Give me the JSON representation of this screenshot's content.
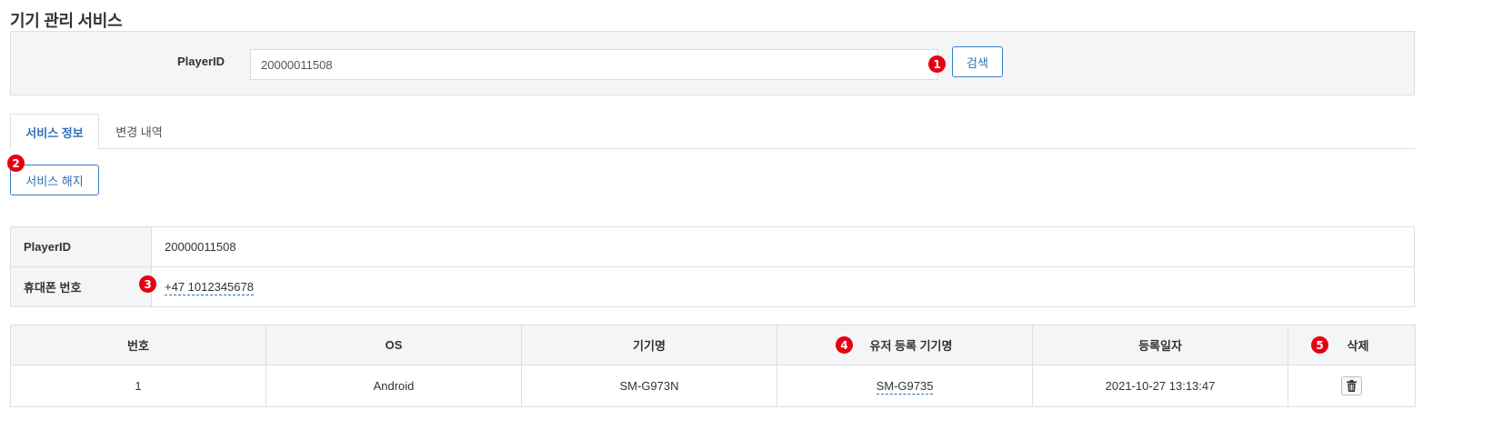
{
  "page": {
    "title": "기기 관리 서비스"
  },
  "search": {
    "label": "PlayerID",
    "value": "20000011508",
    "button_label": "검색"
  },
  "tabs": [
    {
      "label": "서비스 정보",
      "active": true
    },
    {
      "label": "변경 내역",
      "active": false
    }
  ],
  "actions": {
    "cancel_service_label": "서비스 해지"
  },
  "info": {
    "player_id_label": "PlayerID",
    "player_id_value": "20000011508",
    "phone_label": "휴대폰 번호",
    "phone_value": "+47 1012345678"
  },
  "device_table": {
    "headers": [
      "번호",
      "OS",
      "기기명",
      "유저 등록 기기명",
      "등록일자",
      "삭제"
    ],
    "rows": [
      {
        "no": "1",
        "os": "Android",
        "device_name": "SM-G973N",
        "user_device_name": "SM-G9735",
        "registered_at": "2021-10-27 13:13:47"
      }
    ]
  },
  "badges": [
    "1",
    "2",
    "3",
    "4",
    "5"
  ],
  "icons": {
    "delete": "trash-icon"
  },
  "colors": {
    "accent": "#2f6fb5",
    "badge": "#e60012",
    "panel_bg": "#f4f5f7",
    "border": "#dcdfe4"
  }
}
